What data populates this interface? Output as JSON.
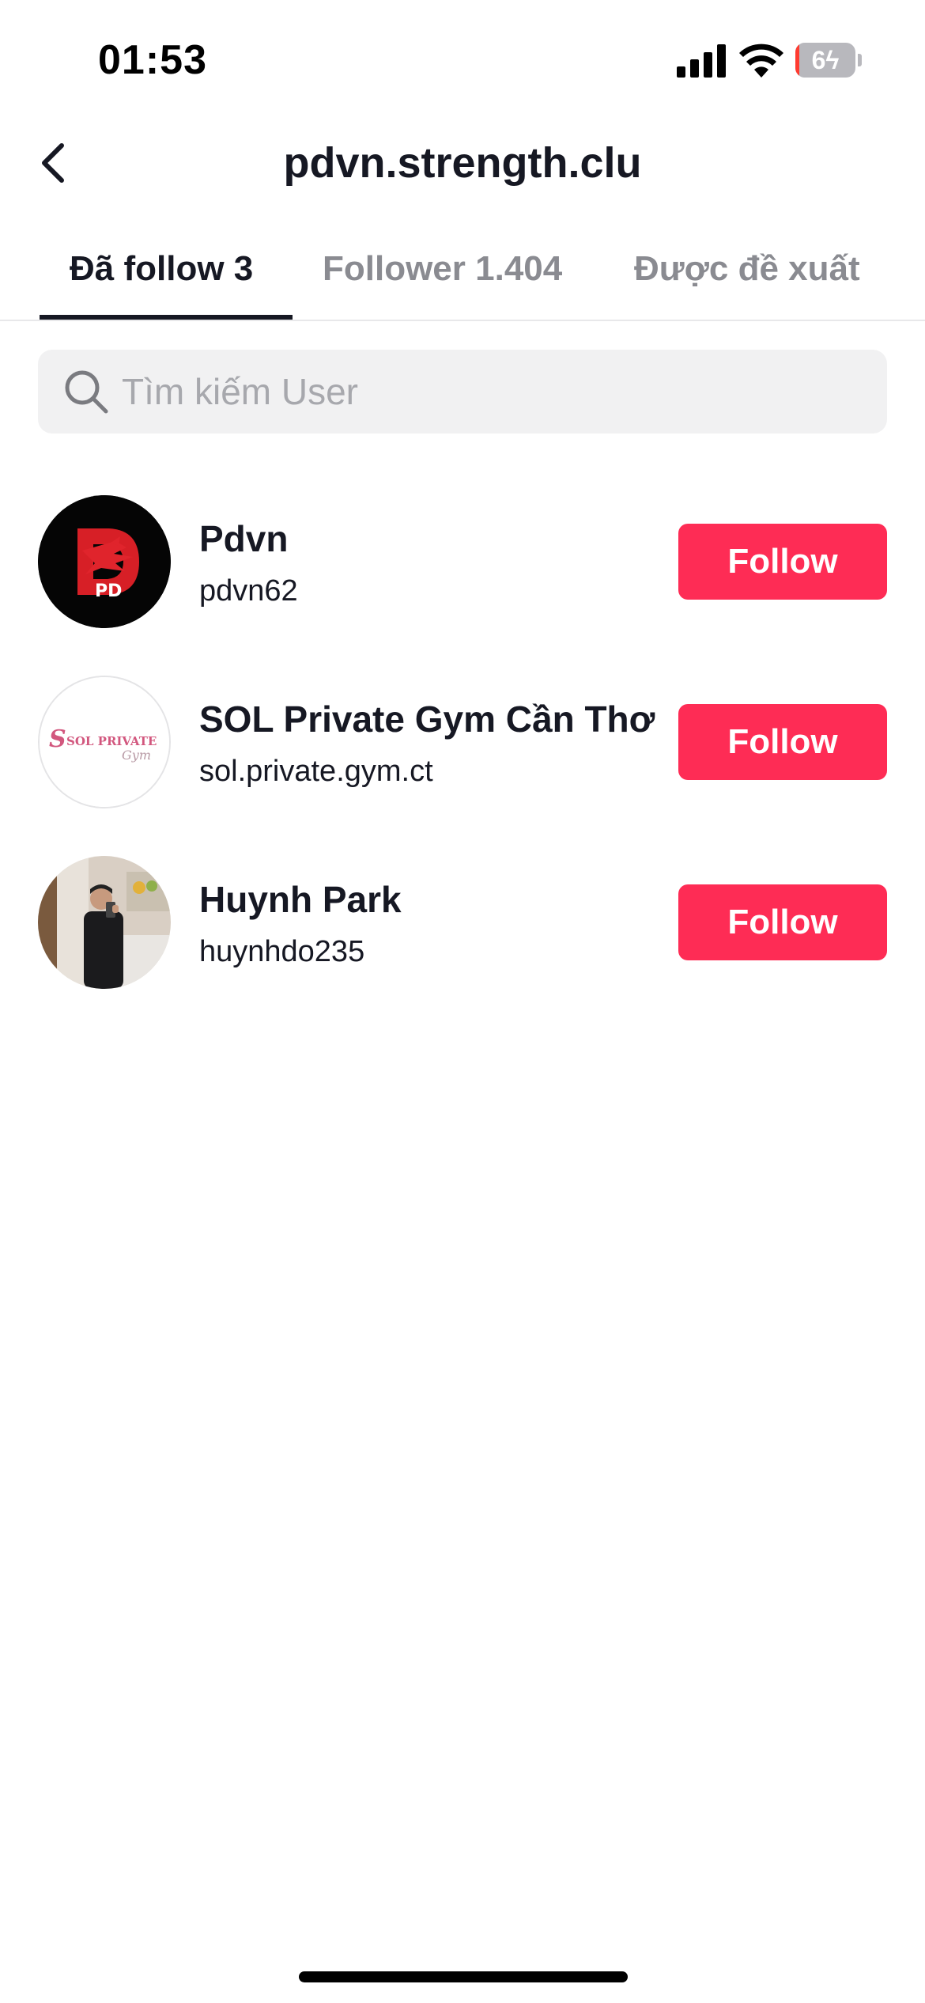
{
  "status_bar": {
    "time": "01:53",
    "battery_level": 6,
    "battery_label": "6",
    "battery_charging": true,
    "battery_color": "#ff3b30",
    "signal_icon": "cellular-signal-icon",
    "wifi_icon": "wifi-icon"
  },
  "header": {
    "title": "pdvn.strength.clu",
    "back_icon": "chevron-left-icon"
  },
  "tabs": [
    {
      "label": "Đã follow 3",
      "active": true
    },
    {
      "label": "Follower 1.404",
      "active": false
    },
    {
      "label": "Được đề xuất",
      "active": false
    }
  ],
  "search": {
    "placeholder": "Tìm kiếm User",
    "value": "",
    "icon": "search-icon"
  },
  "users": [
    {
      "name": "Pdvn",
      "handle": "pdvn62",
      "button_label": "Follow",
      "avatar": "dragon-logo-avatar"
    },
    {
      "name": "SOL Private Gym Cần Thơ",
      "handle": "sol.private.gym.ct",
      "button_label": "Follow",
      "avatar": "sol-private-gym-logo-avatar"
    },
    {
      "name": "Huynh Park",
      "handle": "huynhdo235",
      "button_label": "Follow",
      "avatar": "person-photo-avatar"
    }
  ],
  "colors": {
    "accent": "#fe2c55",
    "text_primary": "#161823",
    "text_secondary": "#8a8b91",
    "search_bg": "#f1f1f2"
  },
  "logos": {
    "pdvn_mark": "PD",
    "sol_mark_1": "SOL PRIVATE",
    "sol_mark_2": "Gym"
  }
}
